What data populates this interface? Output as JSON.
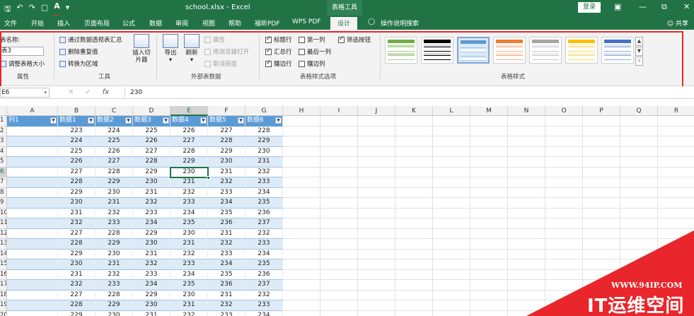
{
  "titlebar": {
    "qat": [
      "save-icon",
      "undo-icon",
      "redo-icon",
      "folder-icon",
      "font-color-icon",
      "customize-icon"
    ],
    "doc_title": "school.xlsx  -  Excel",
    "context_group": "表格工具",
    "login": "登录",
    "window_buttons": [
      "ribbon-options-icon",
      "minimize-icon",
      "restore-icon",
      "close-icon"
    ]
  },
  "menu": {
    "tabs": [
      "文件",
      "开始",
      "插入",
      "页面布局",
      "公式",
      "数据",
      "审阅",
      "视图",
      "帮助",
      "福昕PDF",
      "WPS PDF",
      "设计",
      "操作说明搜索"
    ],
    "active_tab": "设计",
    "share": "共享"
  },
  "ribbon": {
    "properties": {
      "table_name_label": "表名称:",
      "table_name_value": "表3",
      "resize": "调整表格大小",
      "group_label": "属性"
    },
    "tools": {
      "pivot": "通过数据透视表汇总",
      "remove_dup": "删除重复值",
      "convert": "转换为区域",
      "slicer": "插入切片器",
      "group_label": "工具"
    },
    "external": {
      "export": "导出",
      "refresh": "刷新",
      "props": "属性",
      "open_browser": "用浏览器打开",
      "unlink": "取消链接",
      "group_label": "外部表数据"
    },
    "style_options": {
      "header_row": "标题行",
      "first_col": "第一列",
      "filter_btn": "筛选按钮",
      "total_row": "汇总行",
      "last_col": "最后一列",
      "banded_rows": "镶边行",
      "banded_cols": "镶边列",
      "group_label": "表格样式选项",
      "checked": {
        "header_row": true,
        "first_col": false,
        "filter_btn": true,
        "total_row": true,
        "last_col": false,
        "banded_rows": true,
        "banded_cols": false
      }
    },
    "styles": {
      "group_label": "表格样式",
      "swatches": [
        {
          "head": "#70ad47",
          "row": "#c6e0b4",
          "line": "#a9d08e"
        },
        {
          "head": "#000000",
          "row": "#d9d9d9",
          "line": "#000000"
        },
        {
          "head": "#5b9bd5",
          "row": "#ddebf7",
          "line": "#9dc3e6"
        },
        {
          "head": "#ed7d31",
          "row": "#fce4d6",
          "line": "#f4b084"
        },
        {
          "head": "#a5a5a5",
          "row": "#ededed",
          "line": "#c9c9c9"
        },
        {
          "head": "#ffc000",
          "row": "#fff2cc",
          "line": "#ffd966"
        },
        {
          "head": "#4472c4",
          "row": "#d9e1f2",
          "line": "#8ea9db"
        }
      ],
      "selected": 2
    }
  },
  "formula": {
    "name_box": "E6",
    "cancel_icon": "✕",
    "enter_icon": "✓",
    "fx": "fx",
    "value": "230"
  },
  "grid": {
    "columns": [
      "A",
      "B",
      "C",
      "D",
      "E",
      "F",
      "G",
      "H",
      "I",
      "J",
      "K",
      "L",
      "M",
      "N",
      "O",
      "P",
      "Q",
      "R"
    ],
    "active_col": "E",
    "rows": [
      "1",
      "2",
      "3",
      "4",
      "5",
      "6",
      "7",
      "8",
      "9",
      "10",
      "11",
      "12",
      "13",
      "14",
      "15",
      "16",
      "17",
      "18",
      "19",
      "20"
    ],
    "active_row": "6",
    "table_headers": [
      "列1",
      "数据1",
      "数据2",
      "数据3",
      "数据4",
      "数据5",
      "数据6"
    ],
    "table_rows": [
      [
        "",
        "223",
        "224",
        "225",
        "226",
        "227",
        "228"
      ],
      [
        "",
        "224",
        "225",
        "226",
        "227",
        "228",
        "229"
      ],
      [
        "",
        "225",
        "226",
        "227",
        "228",
        "229",
        "230"
      ],
      [
        "",
        "226",
        "227",
        "228",
        "229",
        "230",
        "231"
      ],
      [
        "",
        "227",
        "228",
        "229",
        "230",
        "231",
        "232"
      ],
      [
        "",
        "228",
        "229",
        "230",
        "231",
        "232",
        "233"
      ],
      [
        "",
        "229",
        "230",
        "231",
        "232",
        "233",
        "234"
      ],
      [
        "",
        "230",
        "231",
        "232",
        "233",
        "234",
        "235"
      ],
      [
        "",
        "231",
        "232",
        "233",
        "234",
        "235",
        "236"
      ],
      [
        "",
        "232",
        "233",
        "234",
        "235",
        "236",
        "237"
      ],
      [
        "",
        "227",
        "228",
        "229",
        "230",
        "231",
        "232"
      ],
      [
        "",
        "228",
        "229",
        "230",
        "231",
        "232",
        "233"
      ],
      [
        "",
        "229",
        "230",
        "231",
        "232",
        "233",
        "234"
      ],
      [
        "",
        "230",
        "231",
        "232",
        "233",
        "234",
        "235"
      ],
      [
        "",
        "231",
        "232",
        "233",
        "234",
        "235",
        "236"
      ],
      [
        "",
        "232",
        "233",
        "234",
        "235",
        "236",
        "237"
      ],
      [
        "",
        "227",
        "228",
        "229",
        "230",
        "231",
        "232"
      ],
      [
        "",
        "228",
        "229",
        "230",
        "231",
        "232",
        "233"
      ],
      [
        "",
        "229",
        "230",
        "231",
        "232",
        "233",
        "234"
      ]
    ]
  },
  "watermark": {
    "url": "WWW.94IP.COM",
    "text": "IT运维空间"
  }
}
